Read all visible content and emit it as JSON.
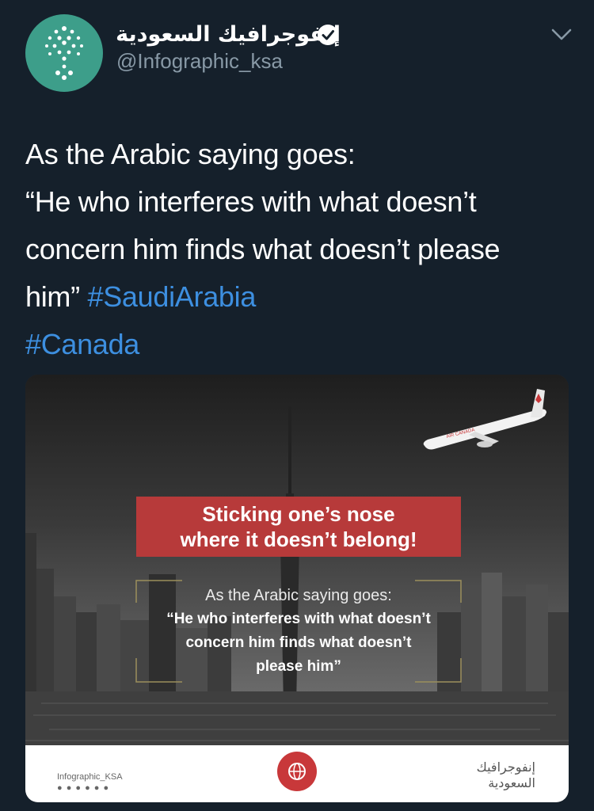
{
  "author": {
    "display_name": "إنفوجرافيك السعودية",
    "handle": "@Infographic_ksa",
    "verified": true,
    "avatar_icon": "infographic-ksa-logo-icon",
    "avatar_color": "#3d9e8a"
  },
  "menu_icon": "chevron-down-icon",
  "tweet": {
    "lines": [
      "As the Arabic saying goes:",
      "“He who interferes with what doesn’t",
      "concern him finds what doesn’t please"
    ],
    "last_line_prefix": "him”",
    "hashtags": [
      "#SaudiArabia",
      "#Canada"
    ],
    "hashtag_color": "#3d8fe0"
  },
  "media": {
    "banner_lines": [
      "Sticking one’s nose",
      "where it doesn’t belong!"
    ],
    "banner_color": "#b73a3a",
    "quote_heading": "As the Arabic saying goes:",
    "quote_lines": [
      "“He who interferes with what doesn’t",
      "concern him finds what doesn’t",
      "please him”"
    ],
    "plane_livery": "AIR CANADA",
    "footer_left_name": "Infographic_KSA",
    "footer_right_lines": [
      "إنفوجرافيك",
      "السعودية"
    ],
    "footer_logo_icon": "globe-icon",
    "footer_logo_color": "#c8383a"
  }
}
